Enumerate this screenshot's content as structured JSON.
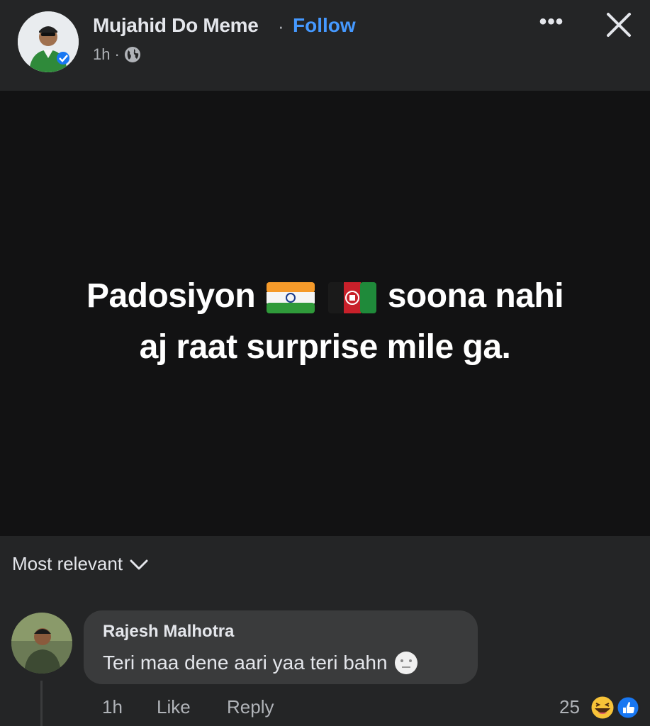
{
  "header": {
    "poster_name": "Mujahid Do Meme",
    "separator": "·",
    "follow_label": "Follow",
    "time": "1h",
    "time_separator": "·",
    "privacy_icon": "globe-icon",
    "more_label": "•••",
    "close_icon": "close-icon"
  },
  "post": {
    "line1_before": "Padosiyon",
    "flags": [
      "flag-india-icon",
      "flag-afghanistan-icon"
    ],
    "line1_after": "soona nahi",
    "line2": "aj raat surprise mile ga."
  },
  "comments_sort": {
    "label": "Most relevant",
    "icon": "chevron-down-icon"
  },
  "comment": {
    "author": "Rajesh Malhotra",
    "text": "Teri maa dene aari yaa teri bahn",
    "emoji_icon": "neutral-face-icon",
    "time": "1h",
    "like_label": "Like",
    "reply_label": "Reply",
    "reaction_count": "25",
    "reaction_icons": [
      "haha-reaction-icon",
      "like-reaction-icon"
    ]
  },
  "colors": {
    "background": "#242526",
    "post_background": "#121213",
    "bubble": "#3a3b3c",
    "link": "#4599ff",
    "text": "#e4e6eb",
    "secondary_text": "#b0b3b8"
  }
}
